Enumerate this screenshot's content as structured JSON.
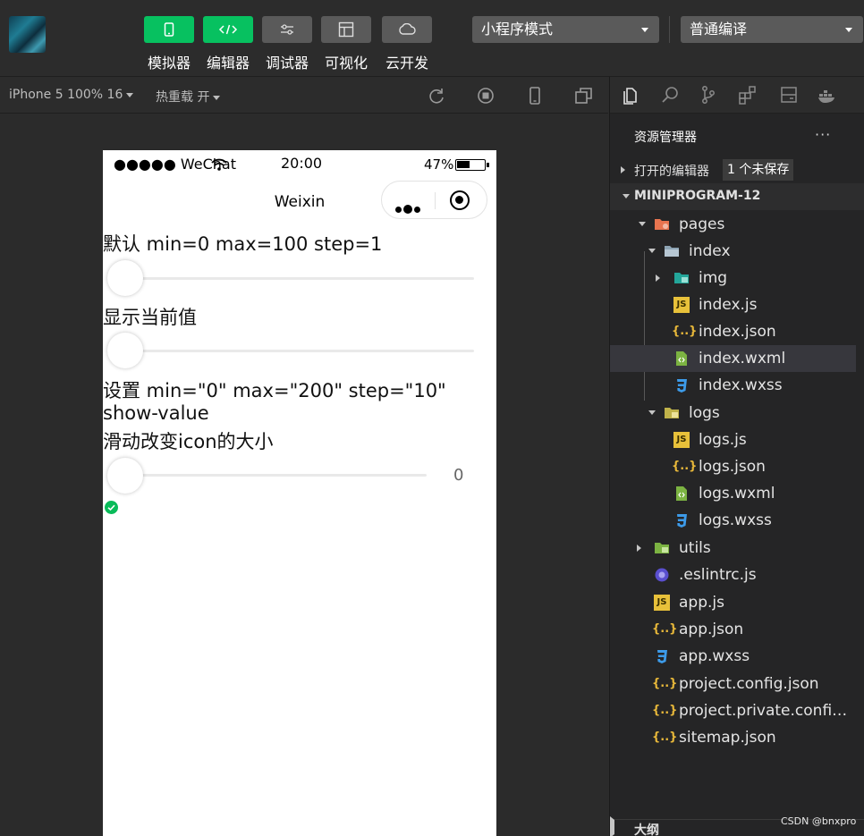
{
  "toolbar": {
    "buttons": [
      {
        "label": "模拟器",
        "icon": "phone-icon"
      },
      {
        "label": "编辑器",
        "icon": "code-icon"
      },
      {
        "label": "调试器",
        "icon": "sliders-icon"
      },
      {
        "label": "可视化",
        "icon": "layout-icon"
      },
      {
        "label": "云开发",
        "icon": "cloud-icon"
      }
    ],
    "mode_select": "小程序模式",
    "compile_select": "普通编译"
  },
  "simbar": {
    "device": "iPhone 5 100% 16",
    "hot_reload": "热重载 开"
  },
  "phone": {
    "carrier": "●●●●● WeChat",
    "time": "20:00",
    "battery": "47%",
    "nav_title": "Weixin",
    "label1": "默认 min=0 max=100 step=1",
    "label2": "显示当前值",
    "label3a": "设置 min=\"0\" max=\"200\" step=\"10\"",
    "label3b": "show-value",
    "label4": "滑动改变icon的大小",
    "slider_value": "0"
  },
  "explorer": {
    "title": "资源管理器",
    "more": "···",
    "open_editors": "打开的编辑器",
    "unsaved_badge": "1 个未保存",
    "project": "MINIPROGRAM-12",
    "files": [
      {
        "name": "pages",
        "icon": "folder-icon"
      },
      {
        "name": "index",
        "icon": "folder-open-icon"
      },
      {
        "name": "img",
        "icon": "image-folder-icon"
      },
      {
        "name": "index.js",
        "icon": "js-file-icon"
      },
      {
        "name": "index.json",
        "icon": "json-file-icon"
      },
      {
        "name": "index.wxml",
        "icon": "wxml-file-icon"
      },
      {
        "name": "index.wxss",
        "icon": "wxss-file-icon"
      },
      {
        "name": "logs",
        "icon": "folder-open-icon"
      },
      {
        "name": "logs.js",
        "icon": "js-file-icon"
      },
      {
        "name": "logs.json",
        "icon": "json-file-icon"
      },
      {
        "name": "logs.wxml",
        "icon": "wxml-file-icon"
      },
      {
        "name": "logs.wxss",
        "icon": "wxss-file-icon"
      },
      {
        "name": "utils",
        "icon": "folder-icon"
      },
      {
        "name": ".eslintrc.js",
        "icon": "eslint-file-icon"
      },
      {
        "name": "app.js",
        "icon": "js-file-icon"
      },
      {
        "name": "app.json",
        "icon": "json-file-icon"
      },
      {
        "name": "app.wxss",
        "icon": "wxss-file-icon"
      },
      {
        "name": "project.config.json",
        "icon": "json-file-icon"
      },
      {
        "name": "project.private.config.js...",
        "icon": "json-file-icon"
      },
      {
        "name": "sitemap.json",
        "icon": "json-file-icon"
      }
    ],
    "outline": "大纲"
  },
  "watermark": "CSDN @bnxpro",
  "colors": {
    "accent_green": "#07c160",
    "panel_bg": "#252526",
    "selected_row": "#37373d"
  }
}
